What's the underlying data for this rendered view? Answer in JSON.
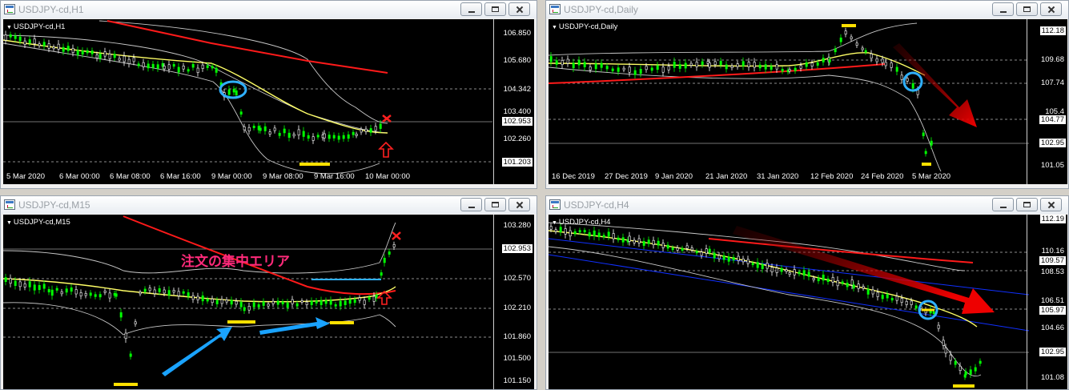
{
  "windows": {
    "h1": {
      "title": "USDJPY-cd,H1",
      "symbol": "USDJPY-cd,H1",
      "prices": [
        "106.850",
        "105.680",
        "104.342",
        "103.400",
        "102.953",
        "102.260",
        "101.203"
      ],
      "times": [
        "5 Mar 2020",
        "6 Mar 00:00",
        "6 Mar 08:00",
        "6 Mar 16:00",
        "9 Mar 00:00",
        "9 Mar 08:00",
        "9 Mar 16:00",
        "10 Mar 00:00"
      ]
    },
    "daily": {
      "title": "USDJPY-cd,Daily",
      "symbol": "USDJPY-cd,Daily",
      "prices": [
        "112.18",
        "109.68",
        "107.74",
        "105.4",
        "104.77",
        "102.95",
        "101.05"
      ],
      "times": [
        "16 Dec 2019",
        "27 Dec 2019",
        "9 Jan 2020",
        "21 Jan 2020",
        "31 Jan 2020",
        "12 Feb 2020",
        "24 Feb 2020",
        "5 Mar 2020"
      ]
    },
    "m15": {
      "title": "USDJPY-cd,M15",
      "symbol": "USDJPY-cd,M15",
      "prices": [
        "103.280",
        "102.953",
        "102.570",
        "102.210",
        "101.860",
        "101.500",
        "101.150"
      ],
      "annotation": "注文の集中エリア"
    },
    "h4": {
      "title": "USDJPY-cd,H4",
      "symbol": "USDJPY-cd,H4",
      "prices": [
        "112.19",
        "110.16",
        "109.57",
        "108.53",
        "106.51",
        "105.97",
        "104.66",
        "102.95",
        "101.08"
      ]
    }
  },
  "colors": {
    "plot_bg": "#000000",
    "bull_candle": "#00ff00",
    "bear_candle": "#ffffff",
    "ma_fast": "#ffff66",
    "ma_slow": "#ff1a1a",
    "bollinger": "#c8c8c8",
    "highlight_yellow": "#ffe000",
    "circle": "#2fb0ff",
    "arrow_blue": "#1aa3ff",
    "arrow_red": "#dd0000",
    "trend_blue": "#1030ff"
  },
  "icons": [
    "window-icon",
    "minimize-icon",
    "maximize-icon",
    "close-icon",
    "red-x-icon",
    "red-up-arrow-icon"
  ]
}
